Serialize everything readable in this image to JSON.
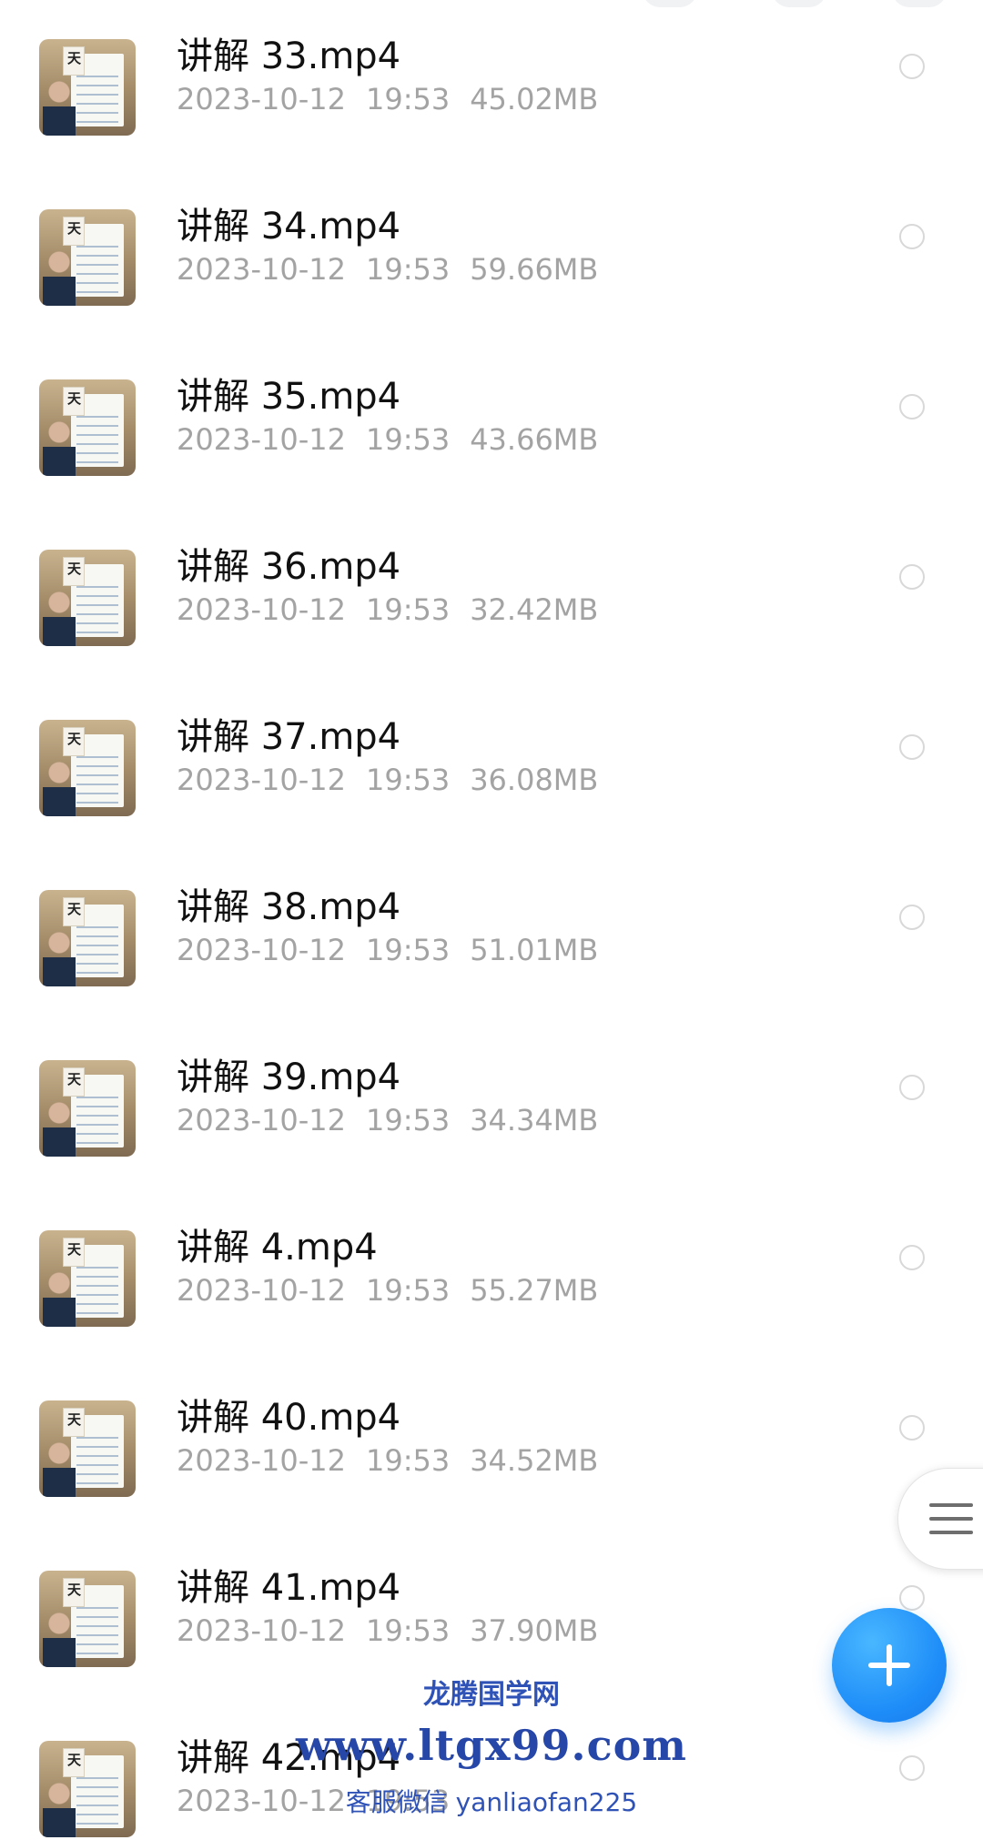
{
  "files": [
    {
      "name": "讲解 33.mp4",
      "date": "2023-10-12",
      "time": "19:53",
      "size": "45.02MB"
    },
    {
      "name": "讲解 34.mp4",
      "date": "2023-10-12",
      "time": "19:53",
      "size": "59.66MB"
    },
    {
      "name": "讲解 35.mp4",
      "date": "2023-10-12",
      "time": "19:53",
      "size": "43.66MB"
    },
    {
      "name": "讲解 36.mp4",
      "date": "2023-10-12",
      "time": "19:53",
      "size": "32.42MB"
    },
    {
      "name": "讲解 37.mp4",
      "date": "2023-10-12",
      "time": "19:53",
      "size": "36.08MB"
    },
    {
      "name": "讲解 38.mp4",
      "date": "2023-10-12",
      "time": "19:53",
      "size": "51.01MB"
    },
    {
      "name": "讲解 39.mp4",
      "date": "2023-10-12",
      "time": "19:53",
      "size": "34.34MB"
    },
    {
      "name": "讲解 4.mp4",
      "date": "2023-10-12",
      "time": "19:53",
      "size": "55.27MB"
    },
    {
      "name": "讲解 40.mp4",
      "date": "2023-10-12",
      "time": "19:53",
      "size": "34.52MB"
    },
    {
      "name": "讲解 41.mp4",
      "date": "2023-10-12",
      "time": "19:53",
      "size": "37.90MB"
    },
    {
      "name": "讲解 42.mp4",
      "date": "2023-10-12",
      "time": "19:53",
      "size": ""
    }
  ],
  "thumbnail_glyph": "天",
  "watermark": {
    "line1": "龙腾国学网",
    "line2": "www.ltgx99.com",
    "line3": "客服微信 yanliaofan225"
  },
  "icons": {
    "side_menu": "hamburger-menu-icon",
    "fab": "plus-icon",
    "select": "radio-circle-icon"
  },
  "colors": {
    "accent": "#1d8cf8",
    "title": "#111111",
    "meta": "#a3a3a3",
    "watermark": "#2f52b7"
  }
}
